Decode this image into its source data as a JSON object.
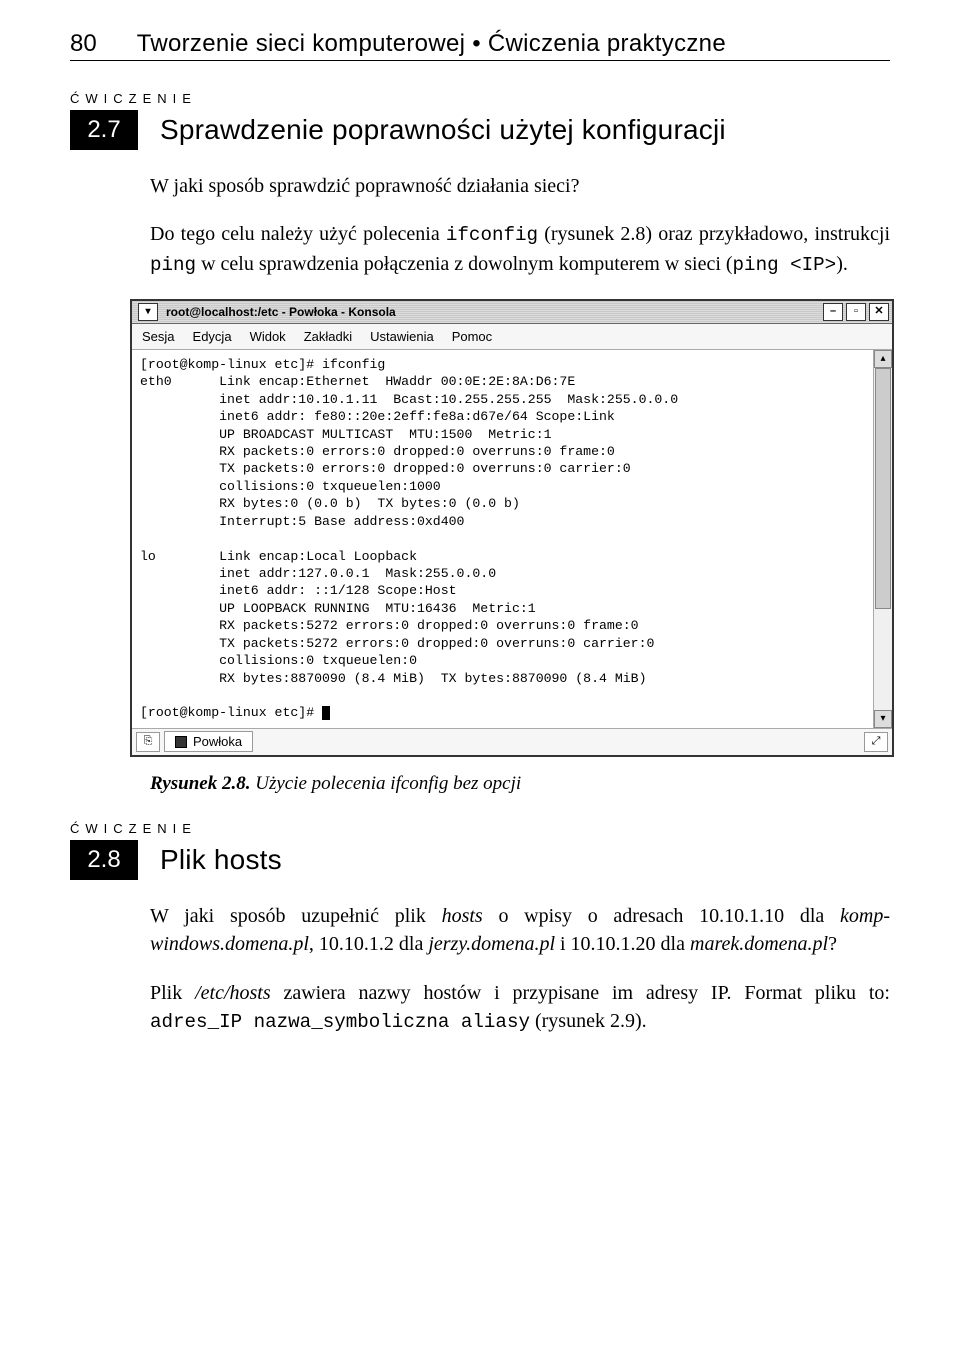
{
  "header": {
    "page_number": "80",
    "title": "Tworzenie sieci komputerowej • Ćwiczenia praktyczne"
  },
  "exercise27": {
    "label": "ĆWICZENIE",
    "number": "2.7",
    "title": "Sprawdzenie poprawności użytej konfiguracji",
    "para1": "W jaki sposób sprawdzić poprawność działania sieci?",
    "para2_a": "Do tego celu należy użyć polecenia ",
    "para2_code1": "ifconfig",
    "para2_b": " (rysunek 2.8) oraz przykładowo, instrukcji ",
    "para2_code2": "ping",
    "para2_c": " w celu sprawdzenia połączenia z dowolnym komputerem w sieci (",
    "para2_code3": "ping <IP>",
    "para2_d": ")."
  },
  "konsole": {
    "title_icon": "▾",
    "title": "root@localhost:/etc - Powłoka - Konsola",
    "btn_min": "–",
    "btn_max": "▫",
    "btn_close": "✕",
    "menu": [
      "Sesja",
      "Edycja",
      "Widok",
      "Zakładki",
      "Ustawienia",
      "Pomoc"
    ],
    "lines": [
      "[root@komp-linux etc]# ifconfig",
      "eth0      Link encap:Ethernet  HWaddr 00:0E:2E:8A:D6:7E",
      "          inet addr:10.10.1.11  Bcast:10.255.255.255  Mask:255.0.0.0",
      "          inet6 addr: fe80::20e:2eff:fe8a:d67e/64 Scope:Link",
      "          UP BROADCAST MULTICAST  MTU:1500  Metric:1",
      "          RX packets:0 errors:0 dropped:0 overruns:0 frame:0",
      "          TX packets:0 errors:0 dropped:0 overruns:0 carrier:0",
      "          collisions:0 txqueuelen:1000",
      "          RX bytes:0 (0.0 b)  TX bytes:0 (0.0 b)",
      "          Interrupt:5 Base address:0xd400",
      "",
      "lo        Link encap:Local Loopback",
      "          inet addr:127.0.0.1  Mask:255.0.0.0",
      "          inet6 addr: ::1/128 Scope:Host",
      "          UP LOOPBACK RUNNING  MTU:16436  Metric:1",
      "          RX packets:5272 errors:0 dropped:0 overruns:0 frame:0",
      "          TX packets:5272 errors:0 dropped:0 overruns:0 carrier:0",
      "          collisions:0 txqueuelen:0",
      "          RX bytes:8870090 (8.4 MiB)  TX bytes:8870090 (8.4 MiB)",
      "",
      "[root@komp-linux etc]# "
    ],
    "scroll_up": "▴",
    "scroll_down": "▾",
    "status_icon1": "⎘",
    "status_tab": "Powłoka",
    "status_icon2": "⤢"
  },
  "caption28": {
    "bold": "Rysunek 2.8.",
    "text": " Użycie polecenia ifconfig bez opcji"
  },
  "exercise28": {
    "label": "ĆWICZENIE",
    "number": "2.8",
    "title": "Plik hosts",
    "p1_a": "W jaki sposób uzupełnić plik ",
    "p1_hosts": "hosts",
    "p1_b": " o wpisy o adresach 10.10.1.10 dla ",
    "p1_d1": "komp-windows.domena.pl",
    "p1_c": ", 10.10.1.2 dla ",
    "p1_d2": "jerzy.domena.pl",
    "p1_d": " i 10.10.1.20 dla ",
    "p1_d3": "marek.domena.pl",
    "p1_e": "?",
    "p2_a": "Plik ",
    "p2_path": "/etc/hosts",
    "p2_b": " zawiera nazwy hostów i przypisane im adresy IP. Format pliku to: ",
    "p2_code": "adres_IP nazwa_symboliczna aliasy",
    "p2_c": " (rysunek 2.9)."
  }
}
